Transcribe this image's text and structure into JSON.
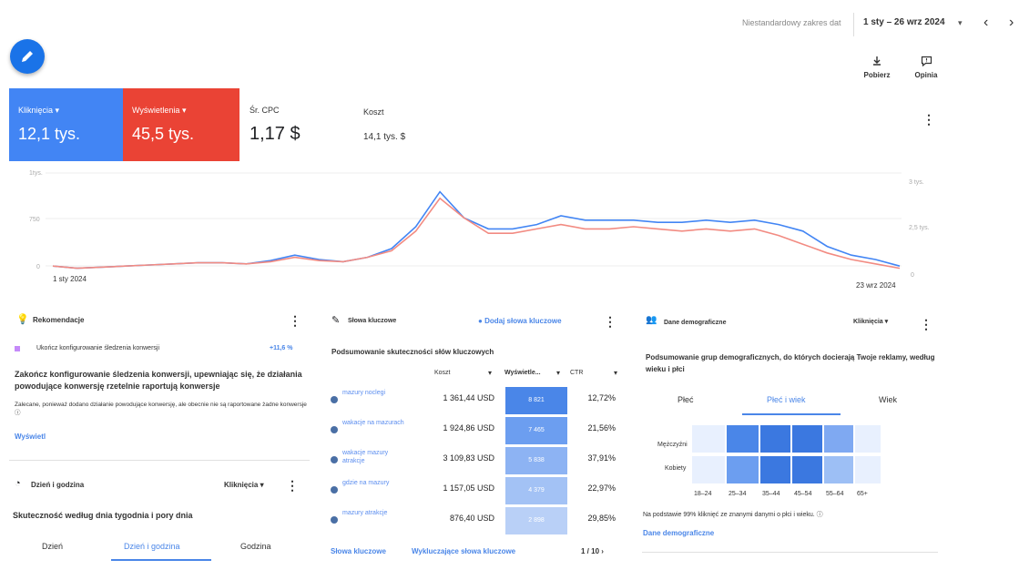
{
  "header": {
    "range_label": "Niestandardowy zakres dat",
    "range_value": "1 sty – 26 wrz 2024",
    "download_label": "Pobierz",
    "feedback_label": "Opinia"
  },
  "metrics": [
    {
      "label": "Kliknięcia",
      "value": "12,1 tys.",
      "color": "#4285f4"
    },
    {
      "label": "Wyświetlenia",
      "value": "45,5 tys.",
      "color": "#ea4335"
    },
    {
      "label": "Śr. CPC",
      "value": "1,17 $"
    },
    {
      "label": "Koszt",
      "value": "14,1 tys. $"
    }
  ],
  "chart_data": {
    "type": "line",
    "x_start_label": "1 sty 2024",
    "x_end_label": "23 wrz 2024",
    "y_left_ticks": [
      "1tys.",
      "750",
      "0"
    ],
    "y_right_ticks": [
      "3 tys.",
      "2,5 tys.",
      "0"
    ],
    "series": [
      {
        "name": "Kliknięcia",
        "color": "#4285f4",
        "values": [
          0.2,
          0.1,
          0.15,
          0.2,
          0.25,
          0.3,
          0.35,
          0.35,
          0.3,
          0.45,
          0.7,
          0.5,
          0.4,
          0.6,
          1.0,
          2.0,
          3.6,
          2.4,
          1.9,
          1.9,
          2.1,
          2.5,
          2.3,
          2.3,
          2.3,
          2.2,
          2.2,
          2.3,
          2.2,
          2.3,
          2.1,
          1.8,
          1.1,
          0.7,
          0.5,
          0.2
        ]
      },
      {
        "name": "Wyświetlenia",
        "color": "#f28b82",
        "values": [
          0.2,
          0.1,
          0.15,
          0.2,
          0.25,
          0.3,
          0.35,
          0.35,
          0.3,
          0.4,
          0.6,
          0.45,
          0.4,
          0.6,
          0.9,
          1.8,
          3.3,
          2.4,
          1.7,
          1.7,
          1.9,
          2.1,
          1.9,
          1.9,
          2.0,
          1.9,
          1.8,
          1.9,
          1.8,
          1.9,
          1.6,
          1.2,
          0.8,
          0.5,
          0.3,
          0.1
        ]
      }
    ]
  },
  "recommendations": {
    "title": "Rekomendacje",
    "item_label": "Ukończ konfigurowanie śledzenia konwersji",
    "item_score": "+11,6 %",
    "headline": "Zakończ konfigurowanie śledzenia konwersji, upewniając się, że działania powodujące konwersję rzetelnie raportują konwersje",
    "body": "Zalecane, ponieważ dodano działanie powodujące konwersję, ale obecnie nie są raportowane żadne konwersje ⓘ",
    "action": "Wyświetl"
  },
  "day_hour": {
    "title": "Dzień i godzina",
    "metric": "Kliknięcia",
    "subtitle": "Skuteczność według dnia tygodnia i pory dnia",
    "tabs": [
      "Dzień",
      "Dzień i godzina",
      "Godzina"
    ]
  },
  "keywords": {
    "title": "Słowa kluczowe",
    "add_label": "Dodaj słowa kluczowe",
    "subtitle": "Podsumowanie skuteczności słów kluczowych",
    "col_cost": "Koszt",
    "col_impr": "Wyświetle...",
    "col_ctr": "CTR",
    "rows": [
      {
        "name": "mazury noclegi",
        "cost": "1 361,44 USD",
        "impr": "8 821",
        "ctr": "12,72%",
        "shade": "#4a86e8"
      },
      {
        "name": "wakacje na mazurach",
        "cost": "1 924,86 USD",
        "impr": "7 465",
        "ctr": "21,56%",
        "shade": "#6c9ef0"
      },
      {
        "name": "wakacje mazury atrakcje",
        "cost": "3 109,83 USD",
        "impr": "5 838",
        "ctr": "37,91%",
        "shade": "#8db3f3"
      },
      {
        "name": "gdzie na mazury",
        "cost": "1 157,05 USD",
        "impr": "4 379",
        "ctr": "22,97%",
        "shade": "#a3c2f5"
      },
      {
        "name": "mazury atrakcje",
        "cost": "876,40 USD",
        "impr": "2 898",
        "ctr": "29,85%",
        "shade": "#b9d0f7"
      }
    ],
    "footer_link1": "Słowa kluczowe",
    "footer_link2": "Wykluczające słowa kluczowe",
    "pager": "1 / 10"
  },
  "demographics": {
    "title": "Dane demograficzne",
    "metric": "Kliknięcia",
    "subtitle": "Podsumowanie grup demograficznych, do których docierają Twoje reklamy, według wieku i płci",
    "tabs": [
      "Płeć",
      "Płeć i wiek",
      "Wiek"
    ],
    "rows": [
      "Mężczyźni",
      "Kobiety"
    ],
    "cols": [
      "18–24",
      "25–34",
      "35–44",
      "45–54",
      "55–64",
      "65+"
    ],
    "note": "Na podstawie 99% kliknięć ze znanymi danymi o płci i wieku. ⓘ",
    "link": "Dane demograficzne"
  }
}
